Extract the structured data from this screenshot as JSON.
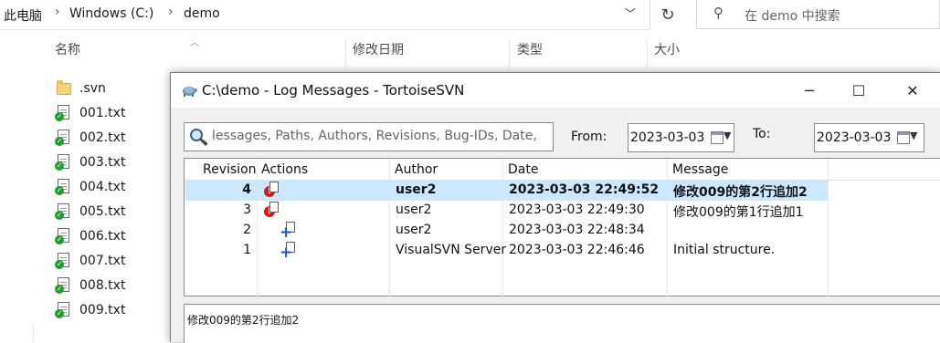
{
  "explorer": {
    "breadcrumb": [
      "此电脑",
      "Windows (C:)",
      "demo"
    ],
    "search_placeholder": "在 demo 中搜索",
    "columns": [
      "名称",
      "修改日期",
      "类型",
      "大小"
    ],
    "files": [
      {
        "name": ".svn",
        "kind": "folder"
      },
      {
        "name": "001.txt",
        "kind": "svn-normal-file"
      },
      {
        "name": "002.txt",
        "kind": "svn-normal-file"
      },
      {
        "name": "003.txt",
        "kind": "svn-normal-file"
      },
      {
        "name": "004.txt",
        "kind": "svn-normal-file"
      },
      {
        "name": "005.txt",
        "kind": "svn-normal-file"
      },
      {
        "name": "006.txt",
        "kind": "svn-normal-file"
      },
      {
        "name": "007.txt",
        "kind": "svn-normal-file"
      },
      {
        "name": "008.txt",
        "kind": "svn-normal-file"
      },
      {
        "name": "009.txt",
        "kind": "svn-normal-file"
      }
    ]
  },
  "dialog": {
    "title": "C:\\demo - Log Messages - TortoiseSVN",
    "filter_text": "lessages, Paths, Authors, Revisions, Bug-IDs, Date,",
    "from_label": "From:",
    "from_date": "2023-03-03",
    "to_label": "To:",
    "to_date": "2023-03-03",
    "columns": [
      "Revision",
      "Actions",
      "Author",
      "Date",
      "Message"
    ],
    "rows": [
      {
        "revision": "4",
        "actions": [
          "modified"
        ],
        "author": "user2",
        "date": "2023-03-03 22:49:52",
        "message": "修改009的第2行追加2",
        "selected": true
      },
      {
        "revision": "3",
        "actions": [
          "modified"
        ],
        "author": "user2",
        "date": "2023-03-03 22:49:30",
        "message": "修改009的第1行追加1",
        "selected": false
      },
      {
        "revision": "2",
        "actions": [
          "added"
        ],
        "author": "user2",
        "date": "2023-03-03 22:48:34",
        "message": "",
        "selected": false
      },
      {
        "revision": "1",
        "actions": [
          "added"
        ],
        "author": "VisualSVN Server",
        "date": "2023-03-03 22:46:46",
        "message": "Initial structure.",
        "selected": false
      }
    ],
    "selected_message": "修改009的第2行追加2"
  },
  "colors": {
    "selection": "#cce8ff",
    "svn_ok_badge": "#1e9e2e",
    "modified_badge": "#d61a1a",
    "added_plus": "#1a56c8"
  }
}
